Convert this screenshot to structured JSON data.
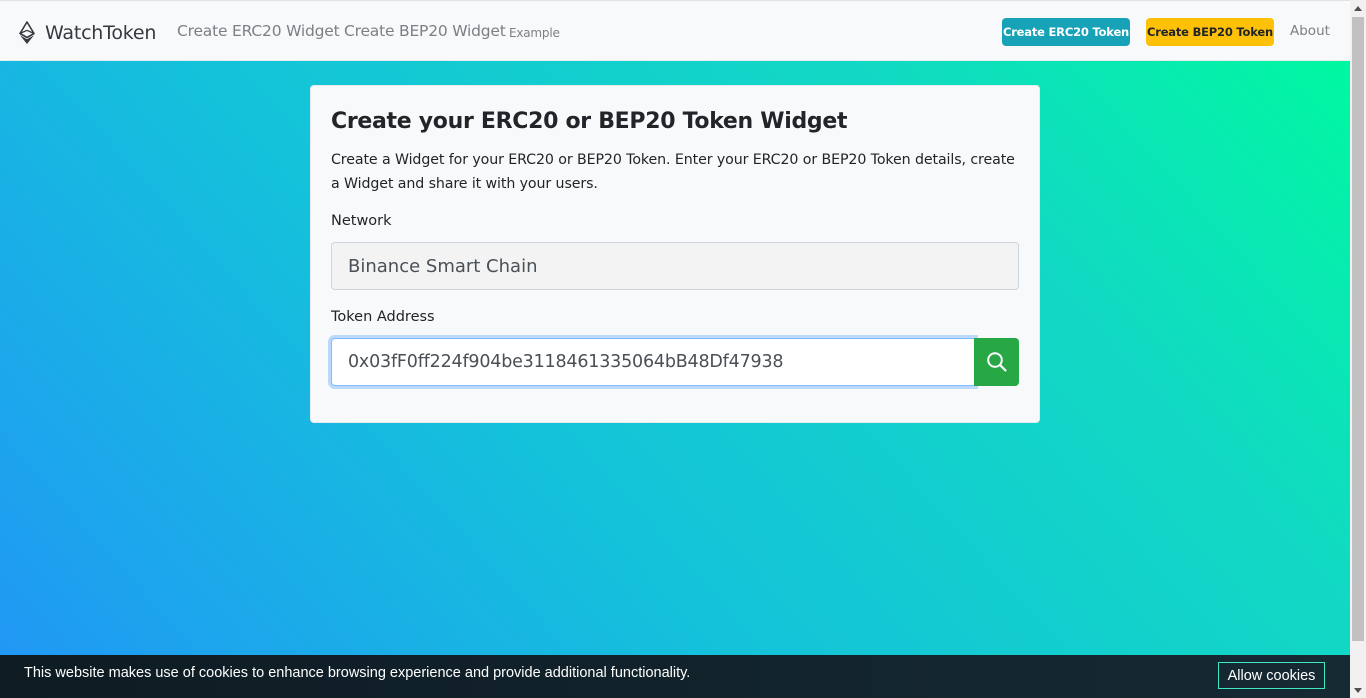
{
  "navbar": {
    "brand": "WatchToken",
    "links": [
      "Create ERC20 Widget",
      "Create BEP20 Widget",
      "Example"
    ],
    "erc20_button": "Create ERC20 Token",
    "bep20_button": "Create BEP20 Token",
    "about": "About"
  },
  "card": {
    "title": "Create your ERC20 or BEP20 Token Widget",
    "description": "Create a Widget for your ERC20 or BEP20 Token. Enter your ERC20 or BEP20 Token details, create a Widget and share it with your users.",
    "network_label": "Network",
    "network_value": "Binance Smart Chain",
    "token_label": "Token Address",
    "token_value": "0x03fF0ff224f904be3118461335064bB48Df47938"
  },
  "cookie": {
    "text": "This website makes use of cookies to enhance browsing experience and provide additional functionality.",
    "button": "Allow cookies"
  },
  "icons": {
    "brand": "ethereum-icon",
    "search": "search-icon"
  },
  "colors": {
    "erc20_button": "#17a2b8",
    "bep20_button": "#ffc107",
    "search_button": "#28a745",
    "gradient_start": "#2196f6",
    "gradient_end": "#00f8a1"
  }
}
